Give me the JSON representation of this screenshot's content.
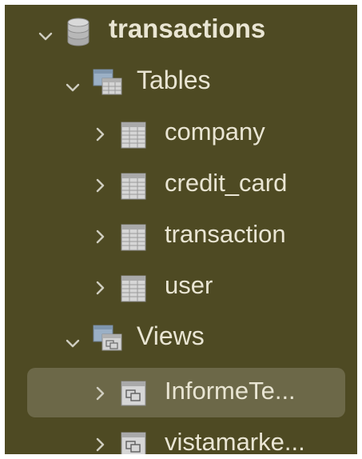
{
  "tree": {
    "database": {
      "label": "transactions",
      "expanded": true,
      "icon": "database-icon"
    },
    "tables_folder": {
      "label": "Tables",
      "expanded": true,
      "icon": "tables-folder-icon"
    },
    "tables": [
      {
        "label": "company",
        "icon": "table-icon"
      },
      {
        "label": "credit_card",
        "icon": "table-icon"
      },
      {
        "label": "transaction",
        "icon": "table-icon"
      },
      {
        "label": "user",
        "icon": "table-icon"
      }
    ],
    "views_folder": {
      "label": "Views",
      "expanded": true,
      "icon": "views-folder-icon"
    },
    "views": [
      {
        "label": "InformeTe...",
        "icon": "view-icon",
        "selected": true
      },
      {
        "label": "vistamarke...",
        "icon": "view-icon"
      }
    ]
  },
  "colors": {
    "background": "#4e4a23",
    "selection": "#6c6848",
    "text": "#e9e5d3",
    "icon": "#cfcfcf"
  }
}
